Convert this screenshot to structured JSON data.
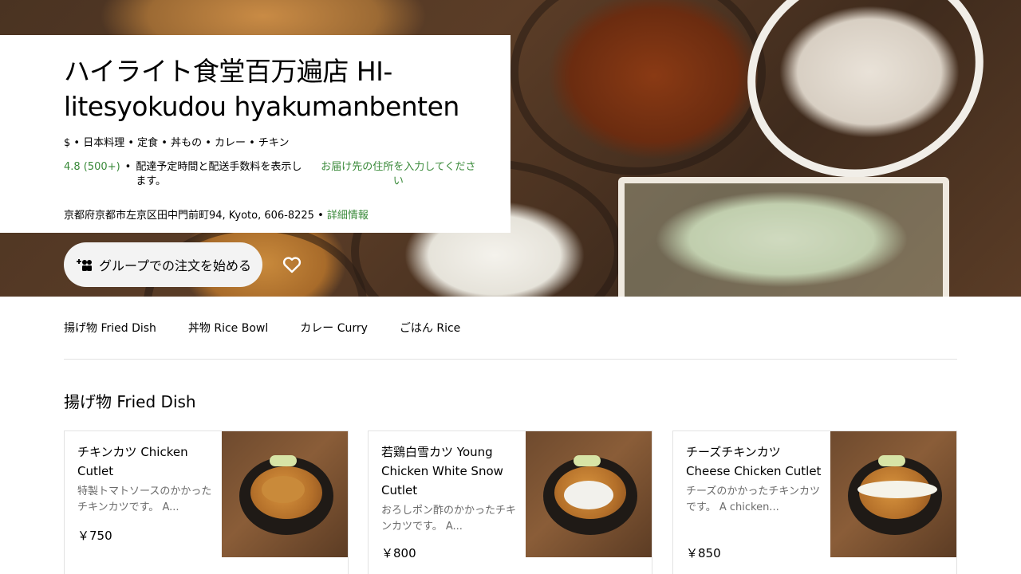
{
  "restaurant": {
    "title": "ハイライト食堂百万遍店 HI-litesyokudou hyakumanbenten",
    "categories": "$ • 日本料理 • 定食 • 丼もの • カレー • チキン",
    "rating": "4.8 (500+)",
    "rating_separator": "•",
    "delivery_note": "配達予定時間と配送手数料を表示します。",
    "address_prompt": "お届け先の住所を入力してください",
    "address": "京都府京都市左京区田中門前町94, Kyoto, 606-8225 • ",
    "more_info": "詳細情報"
  },
  "actions": {
    "group_order": "グループでの注文を始める"
  },
  "tabs": [
    "揚げ物 Fried Dish",
    "丼物 Rice Bowl",
    "カレー Curry",
    "ごはん Rice"
  ],
  "section": {
    "title": "揚げ物 Fried Dish"
  },
  "items": [
    {
      "name": "チキンカツ Chicken Cutlet",
      "desc": "特製トマトソースのかかったチキンカツです。 A...",
      "price": "￥750",
      "topping_color": "#c98a3a"
    },
    {
      "name": "若鶏白雪カツ Young Chicken White Snow Cutlet",
      "desc": "おろしポン酢のかかったチキンカツです。 A...",
      "price": "￥800",
      "topping_color": "#f2f1ec"
    },
    {
      "name": "チーズチキンカツ Cheese Chicken Cutlet",
      "desc": "チーズのかかったチキンカツです。 A chicken...",
      "price": "￥850",
      "topping_color": "#f5f3e9"
    }
  ],
  "colors": {
    "accent_green": "#3a8a3a",
    "button_bg": "#f3f3f3"
  },
  "icons": {
    "group": "group-add-icon",
    "favorite": "heart-icon"
  }
}
